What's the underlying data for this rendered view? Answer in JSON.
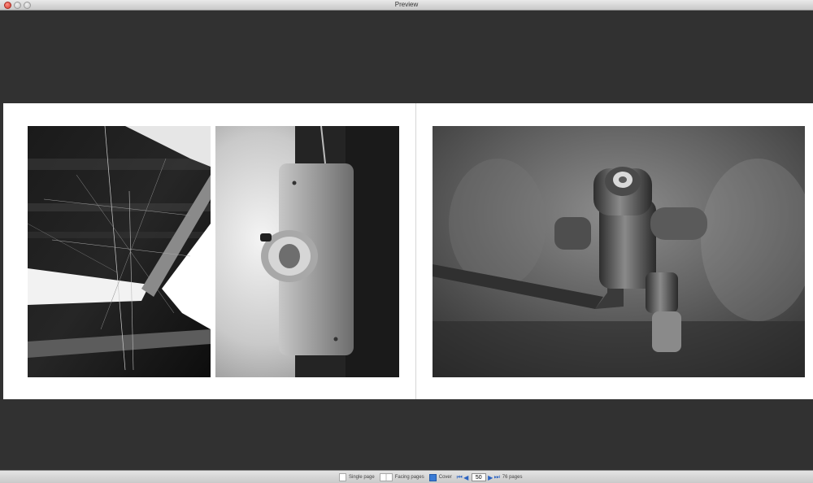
{
  "window": {
    "title": "Preview"
  },
  "photos": {
    "left_1": {
      "icon": "cobweb-photo"
    },
    "left_2": {
      "icon": "light-switch-photo"
    },
    "right": {
      "icon": "faucet-photo"
    }
  },
  "toolbar": {
    "single_label": "Single page",
    "facing_label": "Facing pages",
    "cover_label": "Cover",
    "page_value": "50",
    "pages_label": "76 pages"
  },
  "colors": {
    "accent": "#2b63c2",
    "background": "#313131"
  }
}
